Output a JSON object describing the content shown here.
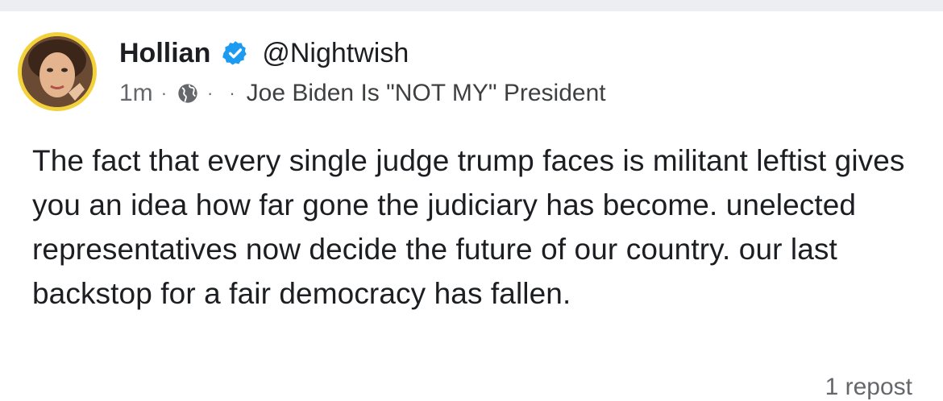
{
  "post": {
    "author_name": "Hollian",
    "handle": "@Nightwish",
    "timestamp": "1m",
    "separator": "·",
    "group_name": "Joe Biden Is \"NOT MY\" President",
    "text": "The fact that every single judge trump faces is militant leftist gives you an idea how far gone the judiciary has become. unelected representatives now decide the future of our country. our last backstop for a fair democracy has fallen.",
    "repost_count": "1 repost",
    "verified_icon": "verified-badge-icon",
    "audience_icon": "globe-icon"
  },
  "colors": {
    "verified_blue": "#1d9bf0",
    "avatar_border": "#f3d13a",
    "secondary_text": "#65676b",
    "primary_text": "#1c1e21"
  }
}
